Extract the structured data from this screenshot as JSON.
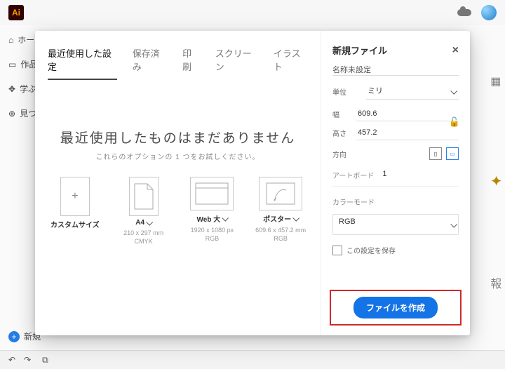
{
  "topbar": {
    "logo_text": "Ai"
  },
  "sidebar": {
    "home": "ホーム",
    "works": "作品",
    "learn": "学ぶ",
    "discover": "見つける",
    "new": "新規"
  },
  "dialog": {
    "tabs": {
      "recent": "最近使用した設定",
      "saved": "保存済み",
      "print": "印刷",
      "screen": "スクリーン",
      "illust": "イラスト"
    },
    "hero": {
      "title": "最近使用したものはまだありません",
      "subtitle": "これらのオプションの 1 つをお試しください。"
    },
    "presets": {
      "custom": {
        "label": "カスタムサイズ"
      },
      "a4": {
        "label": "A4",
        "size": "210 x 297 mm",
        "mode": "CMYK"
      },
      "web": {
        "label": "Web 大",
        "size": "1920 x 1080 px",
        "mode": "RGB"
      },
      "poster": {
        "label": "ポスター",
        "size": "609.6 x 457.2 mm",
        "mode": "RGB"
      }
    },
    "right": {
      "title": "新規ファイル",
      "name_value": "名称未設定",
      "unit_label": "単位",
      "unit_value": "ミリ",
      "width_label": "幅",
      "width_value": "609.6",
      "height_label": "高さ",
      "height_value": "457.2",
      "orient_label": "方向",
      "artboards_label": "アートボード",
      "artboards_value": "1",
      "colormode_label": "カラーモード",
      "colormode_value": "RGB",
      "save_preset": "この設定を保存",
      "create_btn": "ファイルを作成"
    }
  },
  "floaters": {
    "info": "報"
  }
}
